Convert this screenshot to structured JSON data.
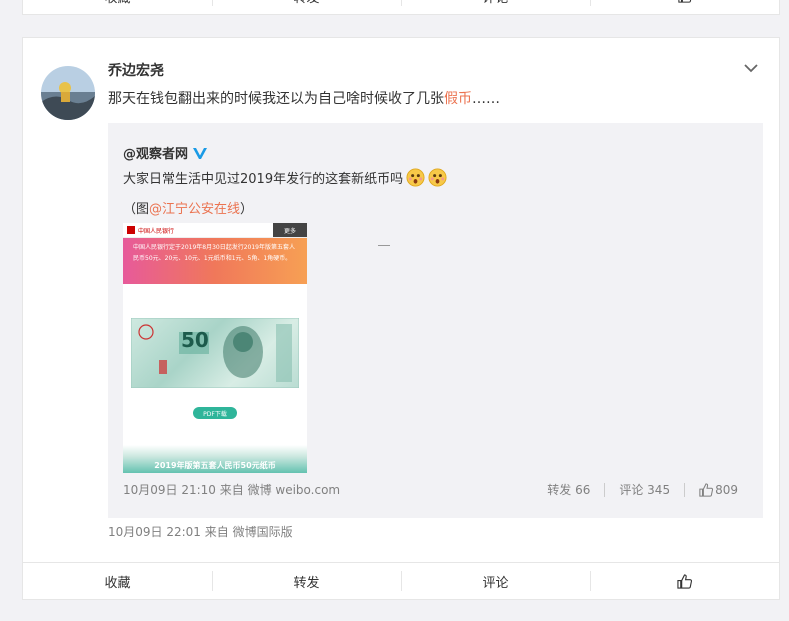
{
  "actions": {
    "collect": "收藏",
    "forward": "转发",
    "comment": "评论"
  },
  "post": {
    "username": "乔边宏尧",
    "text_before": "那天在钱包翻出来的时候我还以为自己啥时候收了几张",
    "text_highlight": "假币",
    "text_after": "……",
    "time": "10月09日 22:01",
    "source": "来自 微博国际版"
  },
  "repost": {
    "user": "@观察者网",
    "text": "大家日常生活中见过2019年发行的这套新纸币吗",
    "credit_prefix": "（图",
    "credit_link": "@江宁公安在线",
    "credit_suffix": "）",
    "time": "10月09日 21:10",
    "source": "来自 微博 weibo.com",
    "forward": "转发 66",
    "comment": "评论 345",
    "likes": "809"
  },
  "thumbnail": {
    "bank_name": "中国人民银行",
    "more": "更多",
    "notice": "中国人民银行定于2019年8月30日起发行2019年版第五套人民币50元、20元、10元、1元纸币和1元、5角、1角硬币。",
    "denomination": "50",
    "pdf": "PDF下载",
    "caption": "2019年版第五套人民币50元纸币"
  },
  "colors": {
    "accent": "#eb7350",
    "verified": "#1a9be6"
  }
}
